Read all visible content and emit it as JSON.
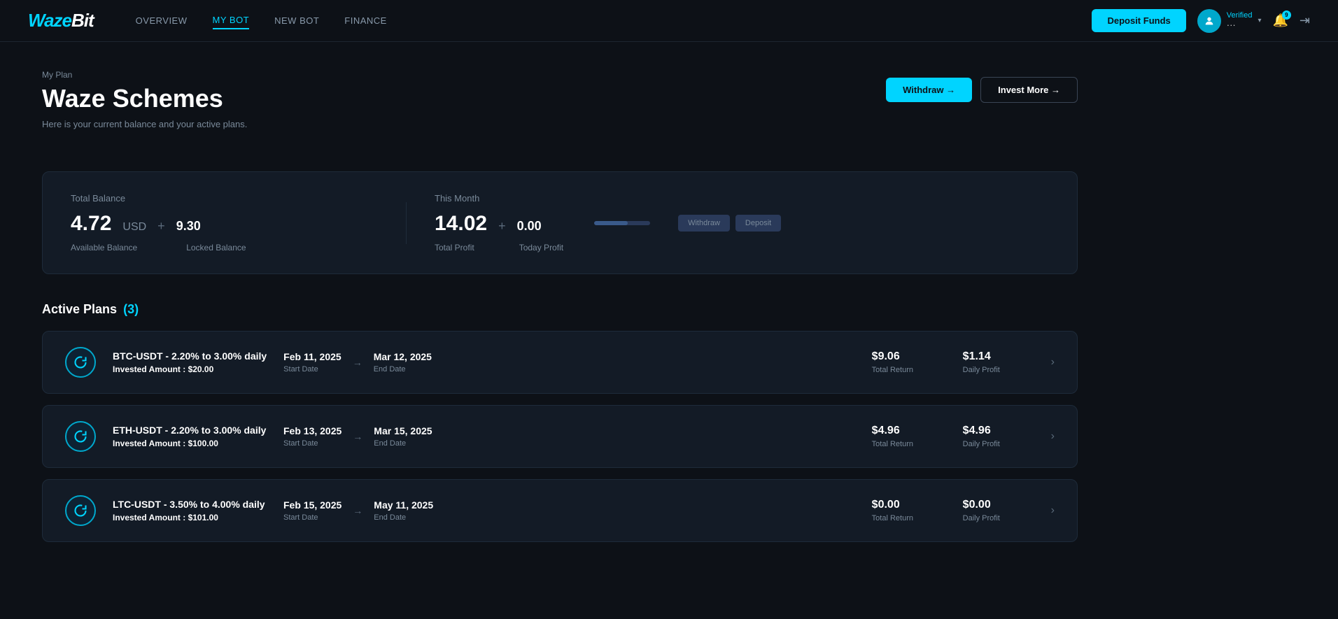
{
  "nav": {
    "logo": "WazeBit",
    "links": [
      {
        "label": "OVERVIEW",
        "active": false
      },
      {
        "label": "MY BOT",
        "active": true
      },
      {
        "label": "NEW BOT",
        "active": false
      },
      {
        "label": "FINANCE",
        "active": false
      }
    ],
    "deposit_btn": "Deposit Funds",
    "user": {
      "verified": "Verified",
      "username": "···",
      "bell_count": "9"
    }
  },
  "page": {
    "subtitle": "My Plan",
    "title": "Waze Schemes",
    "description": "Here is your current balance and your active plans.",
    "withdraw_btn": "Withdraw →",
    "invest_btn": "Invest More →"
  },
  "balance": {
    "total_label": "Total Balance",
    "available_amount": "4.72",
    "available_currency": "USD",
    "locked_amount": "9.30",
    "available_label": "Available Balance",
    "locked_label": "Locked Balance",
    "this_month_label": "This Month",
    "total_profit_val": "14.02",
    "total_profit_label": "Total Profit",
    "today_profit_val": "0.00",
    "today_profit_label": "Today Profit"
  },
  "active_plans": {
    "title": "Active Plans",
    "count": "(3)",
    "plans": [
      {
        "icon": "↻",
        "name": "BTC-USDT - 2.20% to 3.00% daily",
        "invested_label": "Invested Amount :",
        "invested_amount": "$20.00",
        "start_date": "Feb 11, 2025",
        "start_label": "Start Date",
        "end_date": "Mar 12, 2025",
        "end_label": "End Date",
        "total_return": "$9.06",
        "total_return_label": "Total Return",
        "daily_profit": "$1.14",
        "daily_profit_label": "Daily Profit"
      },
      {
        "icon": "↻",
        "name": "ETH-USDT - 2.20% to 3.00% daily",
        "invested_label": "Invested Amount :",
        "invested_amount": "$100.00",
        "start_date": "Feb 13, 2025",
        "start_label": "Start Date",
        "end_date": "Mar 15, 2025",
        "end_label": "End Date",
        "total_return": "$4.96",
        "total_return_label": "Total Return",
        "daily_profit": "$4.96",
        "daily_profit_label": "Daily Profit"
      },
      {
        "icon": "↻",
        "name": "LTC-USDT - 3.50% to 4.00% daily",
        "invested_label": "Invested Amount :",
        "invested_amount": "$101.00",
        "start_date": "Feb 15, 2025",
        "start_label": "Start Date",
        "end_date": "May 11, 2025",
        "end_label": "End Date",
        "total_return": "$0.00",
        "total_return_label": "Total Return",
        "daily_profit": "$0.00",
        "daily_profit_label": "Daily Profit"
      }
    ]
  }
}
